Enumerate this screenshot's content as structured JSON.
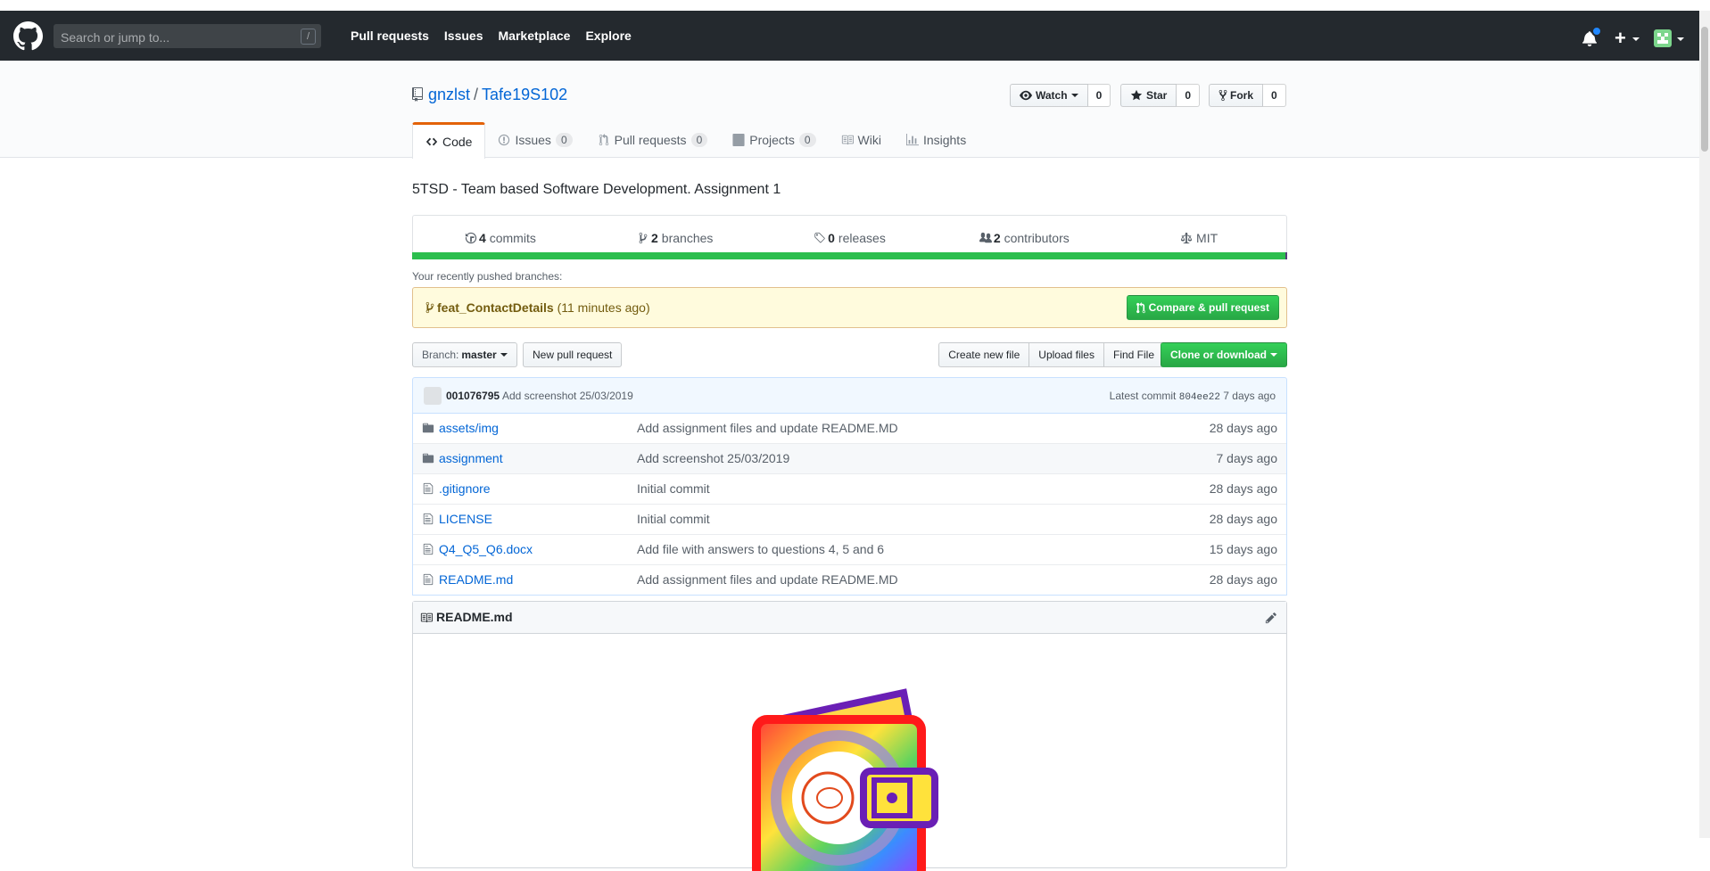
{
  "header": {
    "search_placeholder": "Search or jump to...",
    "search_shortcut": "/",
    "nav": [
      "Pull requests",
      "Issues",
      "Marketplace",
      "Explore"
    ],
    "plus": "+"
  },
  "repo": {
    "owner": "gnzlst",
    "separator": "/",
    "name": "Tafe19S102",
    "watch_label": "Watch",
    "watch_count": "0",
    "star_label": "Star",
    "star_count": "0",
    "fork_label": "Fork",
    "fork_count": "0",
    "tabs": [
      {
        "label": "Code",
        "count": null,
        "icon": "code-icon"
      },
      {
        "label": "Issues",
        "count": "0",
        "icon": "issue-icon"
      },
      {
        "label": "Pull requests",
        "count": "0",
        "icon": "pull-request-icon"
      },
      {
        "label": "Projects",
        "count": "0",
        "icon": "project-icon"
      },
      {
        "label": "Wiki",
        "count": null,
        "icon": "book-icon"
      },
      {
        "label": "Insights",
        "count": null,
        "icon": "graph-icon"
      }
    ],
    "description": "5TSD - Team based Software Development. Assignment 1"
  },
  "numbers": [
    {
      "value": "4",
      "label": "commits",
      "icon": "history-icon"
    },
    {
      "value": "2",
      "label": "branches",
      "icon": "branch-icon"
    },
    {
      "value": "0",
      "label": "releases",
      "icon": "tag-icon"
    },
    {
      "value": "2",
      "label": "contributors",
      "icon": "people-icon"
    },
    {
      "value": "",
      "label": "MIT",
      "icon": "law-icon"
    }
  ],
  "recent": {
    "label": "Your recently pushed branches:",
    "branch": "feat_ContactDetails",
    "time": "(11 minutes ago)",
    "compare_button": "Compare & pull request"
  },
  "filenav": {
    "branch_label": "Branch:",
    "branch_value": "master",
    "new_pr": "New pull request",
    "create_file": "Create new file",
    "upload_files": "Upload files",
    "find_file": "Find File",
    "clone": "Clone or download"
  },
  "commit": {
    "author": "001076795",
    "message": "Add screenshot 25/03/2019",
    "latest_label": "Latest commit",
    "sha": "804ee22",
    "age": "7 days ago"
  },
  "files": [
    {
      "type": "dir",
      "name": "assets/img",
      "message": "Add assignment files and update README.MD",
      "age": "28 days ago"
    },
    {
      "type": "dir",
      "name": "assignment",
      "message": "Add screenshot 25/03/2019",
      "age": "7 days ago"
    },
    {
      "type": "file",
      "name": ".gitignore",
      "message": "Initial commit",
      "age": "28 days ago"
    },
    {
      "type": "file",
      "name": "LICENSE",
      "message": "Initial commit",
      "age": "28 days ago"
    },
    {
      "type": "file",
      "name": "Q4_Q5_Q6.docx",
      "message": "Add file with answers to questions 4, 5 and 6",
      "age": "15 days ago"
    },
    {
      "type": "file",
      "name": "README.md",
      "message": "Add assignment files and update README.MD",
      "age": "28 days ago"
    }
  ],
  "readme": {
    "title": "README.md"
  },
  "colors": {
    "header_bg": "#24292e",
    "link": "#0366d6",
    "green": "#28a745",
    "tab_accent": "#e36209",
    "recent_bg": "#fffbdd"
  }
}
